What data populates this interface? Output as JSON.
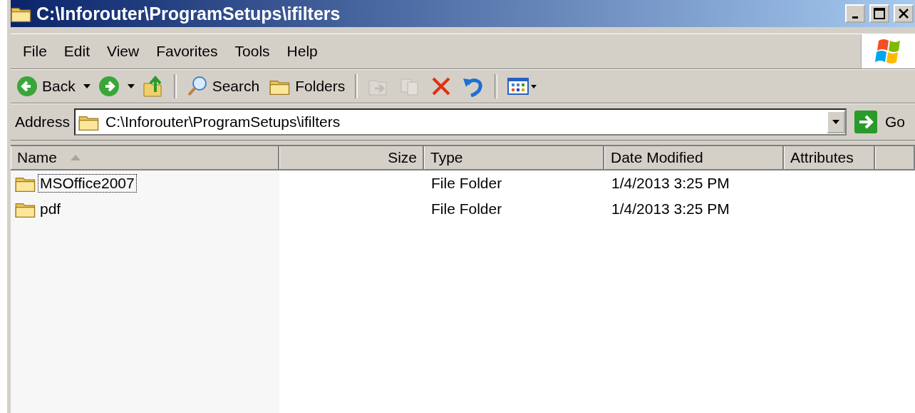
{
  "window": {
    "title": "C:\\Inforouter\\ProgramSetups\\ifilters"
  },
  "menu": [
    "File",
    "Edit",
    "View",
    "Favorites",
    "Tools",
    "Help"
  ],
  "toolbar": [
    {
      "kind": "back",
      "label": "Back",
      "disabled": false
    },
    {
      "kind": "forward",
      "disabled": false
    },
    {
      "kind": "up",
      "disabled": false
    },
    {
      "kind": "separator"
    },
    {
      "kind": "search",
      "label": "Search",
      "disabled": false
    },
    {
      "kind": "folders",
      "label": "Folders",
      "disabled": false
    },
    {
      "kind": "separator"
    },
    {
      "kind": "move",
      "disabled": true
    },
    {
      "kind": "copy",
      "disabled": true
    },
    {
      "kind": "delete",
      "disabled": false
    },
    {
      "kind": "undo",
      "disabled": false
    },
    {
      "kind": "separator"
    },
    {
      "kind": "views",
      "disabled": false
    }
  ],
  "address": {
    "label": "Address",
    "value": "C:\\Inforouter\\ProgramSetups\\ifilters",
    "go": "Go"
  },
  "table": {
    "columns": [
      {
        "label": "Name",
        "sorted": true
      },
      {
        "label": "Size",
        "sorted": false
      },
      {
        "label": "Type",
        "sorted": false
      },
      {
        "label": "Date Modified",
        "sorted": false
      },
      {
        "label": "Attributes",
        "sorted": false
      }
    ],
    "rows": [
      {
        "name": "MSOffice2007",
        "type": "File Folder",
        "date": "1/4/2013 3:25 PM",
        "focused": true
      },
      {
        "name": "pdf",
        "type": "File Folder",
        "date": "1/4/2013 3:25 PM",
        "focused": false
      }
    ]
  }
}
